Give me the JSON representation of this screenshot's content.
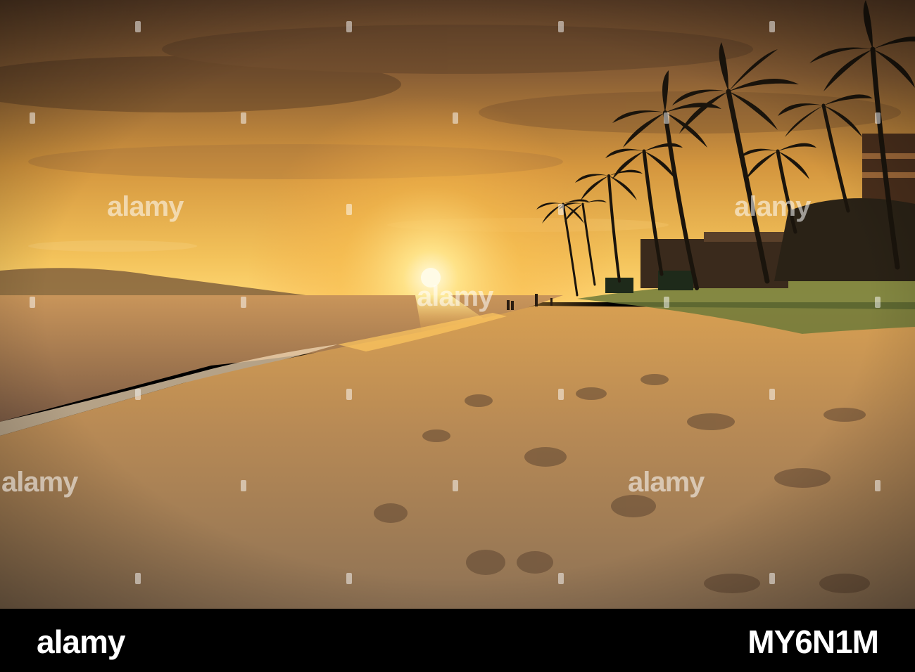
{
  "watermark": {
    "text": "alamy"
  },
  "footer": {
    "brand": "alamy",
    "image_id": "MY6N1M"
  },
  "colors": {
    "sky_top": "#6b4a2e",
    "sky_mid": "#d99a3c",
    "horizon_glow": "#ffd46a",
    "sun": "#fff6cc",
    "sea": "#8a6a4f",
    "sand": "#b8874e",
    "foliage": "#1e1a10",
    "footer_bg": "#000000"
  }
}
